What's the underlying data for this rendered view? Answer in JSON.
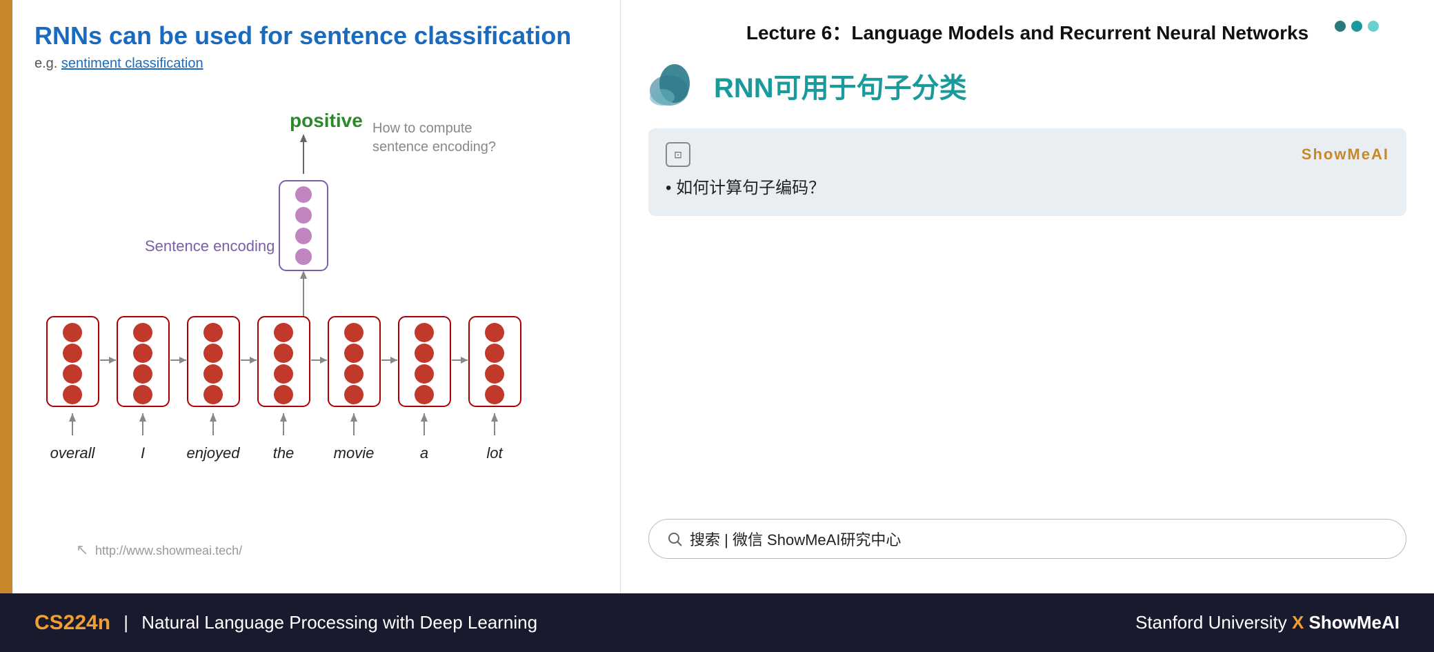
{
  "slide": {
    "title": "RNNs can be used for sentence classification",
    "subtitle_prefix": "e.g.",
    "subtitle_link": "sentiment classification",
    "positive_label": "positive",
    "how_to_compute": "How to compute\nsentence encoding?",
    "sentence_encoding_label": "Sentence encoding",
    "words": [
      "overall",
      "I",
      "enjoyed",
      "the",
      "movie",
      "a",
      "lot"
    ],
    "url": "http://www.showmeai.tech/"
  },
  "right_panel": {
    "lecture_header": "Lecture 6：Language Models and Recurrent Neural Networks",
    "rnn_title": "RNN可用于句子分类",
    "dots": [
      "#2a7a7a",
      "#1a9a9a",
      "#6acfcf"
    ],
    "annotation": {
      "brand": "ShowMeAI",
      "bullet": "如何计算句子编码？"
    }
  },
  "search_bar": {
    "text": "搜索 | 微信 ShowMeAI研究中心"
  },
  "bottom_bar": {
    "cs224n": "CS224n",
    "separator": "|",
    "course_title": "Natural Language Processing with Deep Learning",
    "right_text": "Stanford University",
    "x": "X",
    "brand": "ShowMeAI"
  }
}
